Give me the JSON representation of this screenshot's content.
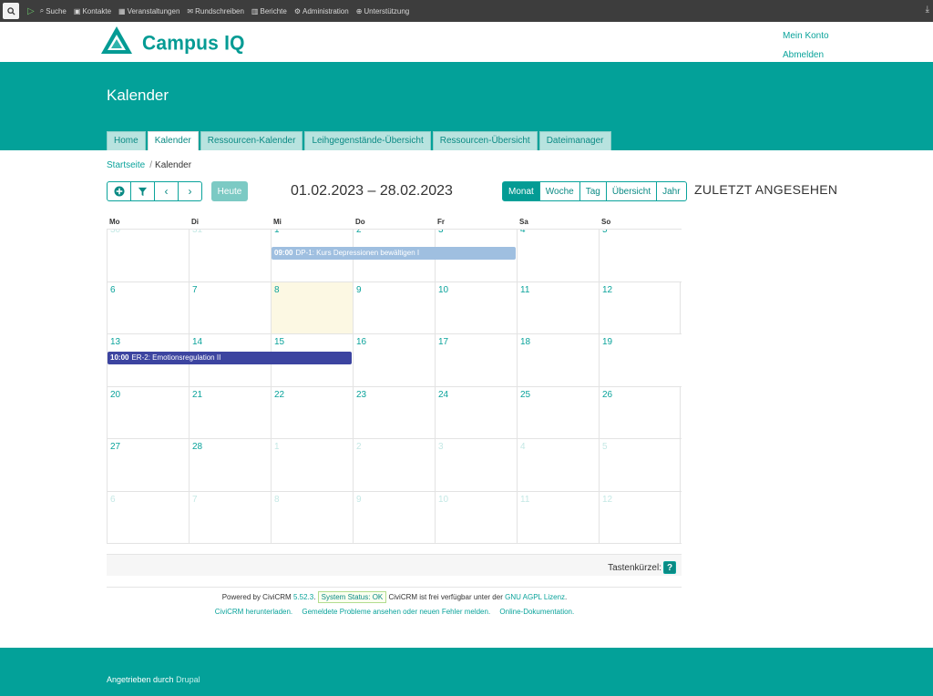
{
  "adminbar": {
    "items": [
      {
        "icon": "search-icon",
        "label": "Suche"
      },
      {
        "icon": "contacts-icon",
        "label": "Kontakte"
      },
      {
        "icon": "calendar-icon",
        "label": "Veranstaltungen"
      },
      {
        "icon": "mail-icon",
        "label": "Rundschreiben"
      },
      {
        "icon": "bar-chart-icon",
        "label": "Berichte"
      },
      {
        "icon": "gears-icon",
        "label": "Administration"
      },
      {
        "icon": "lifebuoy-icon",
        "label": "Unterstützung"
      }
    ]
  },
  "header": {
    "logo_text": "Campus IQ",
    "account_link": "Mein Konto",
    "logout_link": "Abmelden"
  },
  "page": {
    "title": "Kalender",
    "tabs": [
      "Home",
      "Kalender",
      "Ressourcen-Kalender",
      "Leihgegenstände-Übersicht",
      "Ressourcen-Übersicht",
      "Dateimanager"
    ],
    "active_tab": "Kalender"
  },
  "breadcrumb": {
    "home": "Startseite",
    "current": "Kalender"
  },
  "toolbar": {
    "today_label": "Heute",
    "range_title": "01.02.2023 – 28.02.2023",
    "views": [
      "Monat",
      "Woche",
      "Tag",
      "Übersicht",
      "Jahr"
    ],
    "active_view": "Monat"
  },
  "sidebar": {
    "recent_title": "ZULETZT ANGESEHEN"
  },
  "calendar": {
    "weekdays": [
      "Mo",
      "Di",
      "Mi",
      "Do",
      "Fr",
      "Sa",
      "So"
    ],
    "weeks": [
      [
        {
          "d": "30",
          "o": true
        },
        {
          "d": "31",
          "o": true
        },
        {
          "d": "1"
        },
        {
          "d": "2"
        },
        {
          "d": "3"
        },
        {
          "d": "4"
        },
        {
          "d": "5"
        }
      ],
      [
        {
          "d": "6"
        },
        {
          "d": "7"
        },
        {
          "d": "8",
          "today": true
        },
        {
          "d": "9"
        },
        {
          "d": "10"
        },
        {
          "d": "11"
        },
        {
          "d": "12"
        }
      ],
      [
        {
          "d": "13"
        },
        {
          "d": "14"
        },
        {
          "d": "15"
        },
        {
          "d": "16"
        },
        {
          "d": "17"
        },
        {
          "d": "18"
        },
        {
          "d": "19"
        }
      ],
      [
        {
          "d": "20"
        },
        {
          "d": "21"
        },
        {
          "d": "22"
        },
        {
          "d": "23"
        },
        {
          "d": "24"
        },
        {
          "d": "25"
        },
        {
          "d": "26"
        }
      ],
      [
        {
          "d": "27"
        },
        {
          "d": "28"
        },
        {
          "d": "1",
          "o": true
        },
        {
          "d": "2",
          "o": true
        },
        {
          "d": "3",
          "o": true
        },
        {
          "d": "4",
          "o": true
        },
        {
          "d": "5",
          "o": true
        }
      ],
      [
        {
          "d": "6",
          "o": true
        },
        {
          "d": "7",
          "o": true
        },
        {
          "d": "8",
          "o": true
        },
        {
          "d": "9",
          "o": true
        },
        {
          "d": "10",
          "o": true
        },
        {
          "d": "11",
          "o": true
        },
        {
          "d": "12",
          "o": true
        }
      ]
    ],
    "events": [
      {
        "time": "09:00",
        "title": "DP-1: Kurs Depressionen bewältigen I",
        "color": "#9fbfe0"
      },
      {
        "time": "10:00",
        "title": "ER-2: Emotionsregulation II",
        "color": "#3c44a0"
      }
    ],
    "shortcut_label": "Tastenkürzel:"
  },
  "civicrm": {
    "powered_prefix": "Powered by CiviCRM",
    "version": "5.52.3",
    "status": "System Status: OK",
    "license_text": "CiviCRM ist frei verfügbar unter der",
    "license_link": "GNU AGPL Lizenz",
    "links": [
      "CiviCRM herunterladen.",
      "Gemeldete Probleme ansehen oder neuen Fehler melden.",
      "Online-Dokumentation."
    ]
  },
  "footer": {
    "powered_by": "Angetrieben durch",
    "drupal": "Drupal"
  },
  "colors": {
    "teal": "#03a199",
    "accent": "#0aa39b",
    "today": "#fcf8e3"
  }
}
